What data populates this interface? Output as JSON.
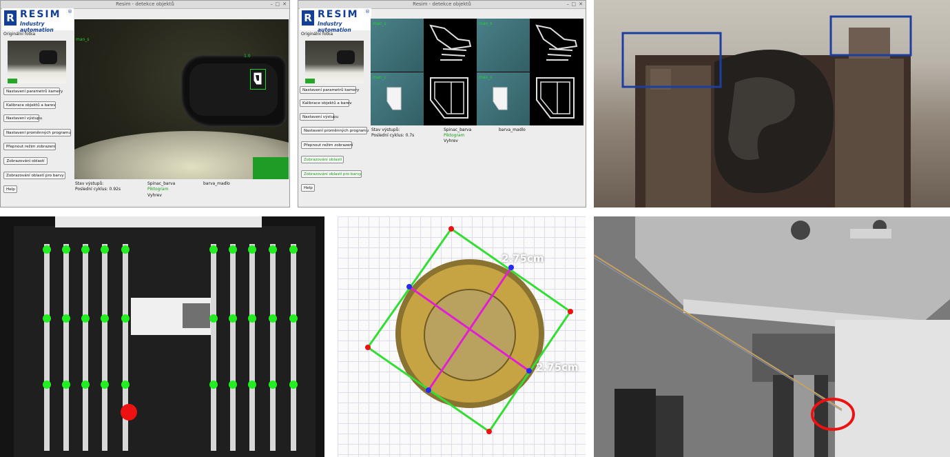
{
  "window_left": {
    "title": "Resim - detekce objektů",
    "logo": {
      "name": "RESIM",
      "tagline": "Industry automation",
      "reg": "®",
      "mark": "R"
    },
    "original_photo_label": "Originální fotka",
    "buttons": [
      "Nastavení parametrů kamery",
      "Kalibrace objektů a barev",
      "Nastavení výstupu",
      "Nastavení proměnných programu",
      "Přepnout režim zobrazení",
      "Zobrazování oblastí",
      "Zobrazování oblastí pro barvy",
      "Help"
    ],
    "camera_label": "man_s",
    "detection_score": "1.0",
    "status": {
      "outputs_label": "Stav výstupů:",
      "cycle_label": "Poslední cyklus: 0.92s",
      "col_a": "Spinac_barva",
      "col_a_sub": "Piktogram",
      "col_a_sub2": "Vyhrev",
      "col_b": "barva_madlo"
    }
  },
  "window_right": {
    "title": "Resim - detekce objektů",
    "logo": {
      "name": "RESIM",
      "tagline": "Industry automation",
      "reg": "®",
      "mark": "R"
    },
    "original_photo_label": "Originální fotka",
    "buttons": [
      "Nastavení parametrů kamery",
      "Kalibrace objektů a barev",
      "Nastavení výstupu",
      "Nastavení proměnných programu",
      "Přepnout režim zobrazení",
      "Zobrazování oblastí",
      "Zobrazování oblastí pro barvy",
      "Help"
    ],
    "picto_labels": [
      "man_s",
      "man_s",
      "man_c",
      "man_c"
    ],
    "status": {
      "outputs_label": "Stav výstupů:",
      "cycle_label": "Poslední cyklus: 0.7s",
      "col_a": "Spinac_barva",
      "col_a_sub": "Piktogram",
      "col_a_sub2": "Vyhrev",
      "col_b": "barva_madlo"
    }
  },
  "coin": {
    "measure_top": "2.75cm",
    "measure_right": "2.75cm"
  },
  "colors": {
    "brand": "#143f96",
    "detect_green": "#1fd62a",
    "measure_line": "#33dd33",
    "diag": "#e020d0"
  }
}
